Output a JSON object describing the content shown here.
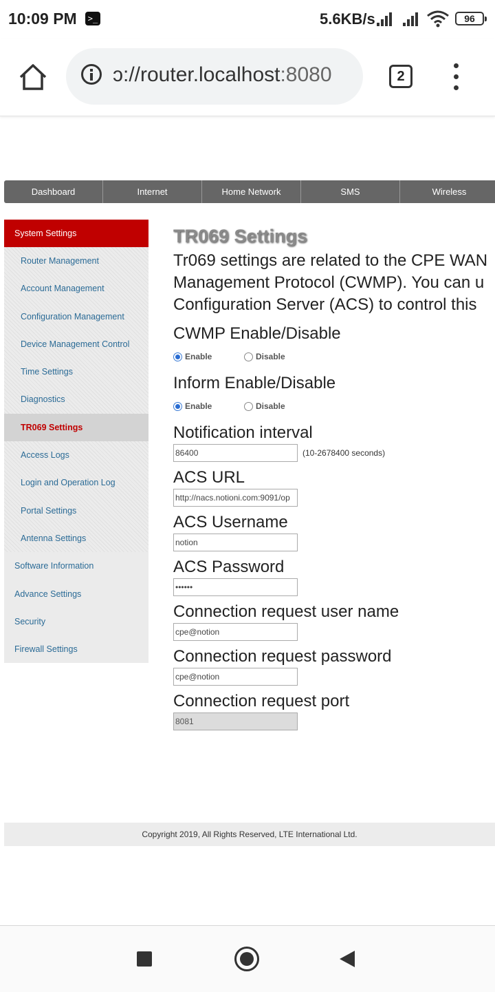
{
  "status_bar": {
    "time": "10:09 PM",
    "speed": "5.6KB/s",
    "battery": "96"
  },
  "browser": {
    "url_scheme_part": "ɔ://router.localhost",
    "url_port": ":8080",
    "tab_count": "2"
  },
  "topnav": {
    "items": [
      "Dashboard",
      "Internet",
      "Home Network",
      "SMS",
      "Wireless"
    ]
  },
  "sidebar": {
    "header": "System Settings",
    "sub_items": [
      "Router Management",
      "Account Management",
      "Configuration Management",
      "Device Management Control",
      "Time Settings",
      "Diagnostics",
      "TR069 Settings",
      "Access Logs",
      "Login and Operation Log",
      "Portal Settings",
      "Antenna Settings"
    ],
    "active_index": 6,
    "top_items": [
      "Software Information",
      "Advance Settings",
      "Security",
      "Firewall Settings"
    ]
  },
  "main": {
    "title": "TR069 Settings",
    "desc_lines": [
      "Tr069 settings are related to the CPE WAN",
      "Management Protocol (CWMP). You can u",
      "Configuration Server (ACS) to control this"
    ],
    "cwmp_label": "CWMP Enable/Disable",
    "inform_label": "Inform Enable/Disable",
    "enable_label": "Enable",
    "disable_label": "Disable",
    "cwmp_selected": "Enable",
    "inform_selected": "Enable",
    "notification_label": "Notification interval",
    "notification_value": "86400",
    "notification_hint": "(10-2678400 seconds)",
    "acs_url_label": "ACS URL",
    "acs_url_value": "http://nacs.notioni.com:9091/op",
    "acs_username_label": "ACS Username",
    "acs_username_value": "notion",
    "acs_password_label": "ACS Password",
    "acs_password_value": "••••••",
    "conn_user_label": "Connection request user name",
    "conn_user_value": "cpe@notion",
    "conn_pass_label": "Connection request password",
    "conn_pass_value": "cpe@notion",
    "conn_port_label": "Connection request port",
    "conn_port_value": "8081"
  },
  "footer": {
    "text": "Copyright 2019, All Rights Reserved, LTE International Ltd."
  }
}
